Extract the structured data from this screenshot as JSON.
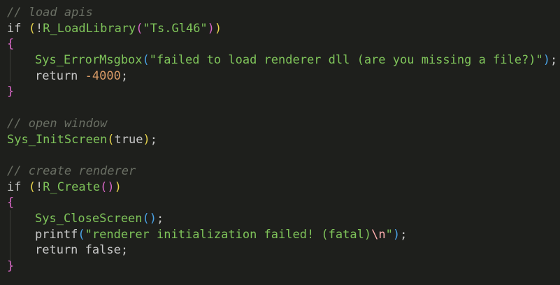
{
  "code": {
    "comment_load": "// load apis",
    "kw_if": "if",
    "bang_load": "!",
    "fn_loadlibrary": "R_LoadLibrary",
    "str_gl46": "\"Ts.Gl46\"",
    "fn_errormsgbox": "Sys_ErrorMsgbox",
    "str_failed": "\"failed to load renderer dll (are you missing a file?)\"",
    "kw_return": "return",
    "num_4000": "-4000",
    "comment_open": "// open window",
    "fn_initscreen": "Sys_InitScreen",
    "kw_true": "true",
    "comment_create": "// create renderer",
    "fn_rcreate": "R_Create",
    "fn_closescreen": "Sys_CloseScreen",
    "fn_printf": "printf",
    "str_init_failed": "\"renderer initialization failed! (fatal)",
    "str_escape": "\\n",
    "str_quote": "\"",
    "kw_false": "false"
  }
}
